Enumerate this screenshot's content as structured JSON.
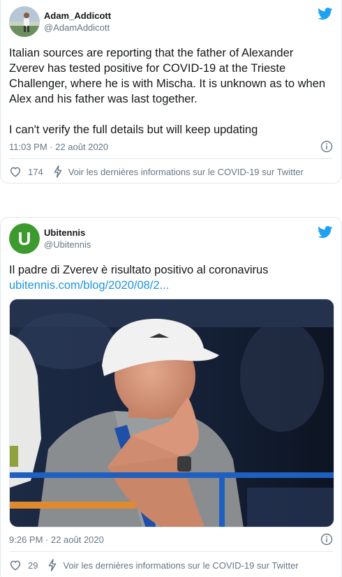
{
  "tweets": [
    {
      "display_name": "Adam_Addicott",
      "handle": "@AdamAddicott",
      "avatar_icon": "profile-photo",
      "paragraphs": [
        "Italian sources are reporting that the father of Alexander Zverev has tested positive for COVID-19 at the Trieste Challenger, where he is with Mischa. It is unknown as to when Alex and his father was last together.",
        "I can't verify the full details but will keep updating"
      ],
      "timestamp": "11:03 PM · 22 août 2020",
      "likes": "174",
      "covid_link": "Voir les dernières informations sur le COVID-19 sur Twitter"
    },
    {
      "display_name": "Ubitennis",
      "handle": "@Ubitennis",
      "avatar_letter": "U",
      "body_text": "Il padre di Zverev è risultato positivo al coronavirus",
      "link_text": "ubitennis.com/blog/2020/08/2...",
      "media_icon": "photo-man-in-white-cap",
      "timestamp": "9:26 PM · 22 août 2020",
      "likes": "29",
      "covid_link": "Voir les dernières informations sur le COVID-19 sur Twitter"
    }
  ],
  "colors": {
    "twitter_blue": "#1da1f2",
    "link_blue": "#1b95e0",
    "secondary_text": "#657786",
    "ubitennis_green": "#3c9a2e"
  }
}
